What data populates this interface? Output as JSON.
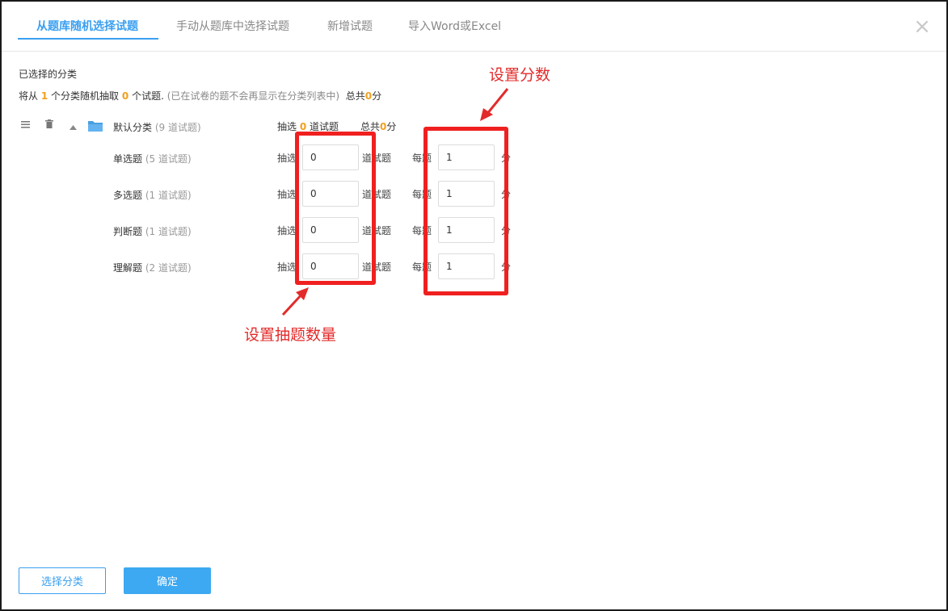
{
  "tabs": [
    {
      "label": "从题库随机选择试题"
    },
    {
      "label": "手动从题库中选择试题"
    },
    {
      "label": "新增试题"
    },
    {
      "label": "导入Word或Excel"
    }
  ],
  "close_symbol": "×",
  "selected_label": "已选择的分类",
  "summary": {
    "prefix": "将从",
    "category_count": "1",
    "middle": "个分类随机抽取",
    "question_count": "0",
    "suffix": "个试题.",
    "hint": "(已在试卷的题不会再显示在分类列表中)",
    "total_label": "总共",
    "total_value": "0",
    "total_unit": "分"
  },
  "category": {
    "name": "默认分类",
    "count": "(9 道试题)",
    "pick_label": "抽选",
    "pick_value": "0",
    "pick_unit": "道试题",
    "total_label": "总共",
    "total_value": "0",
    "total_unit": "分",
    "icons": {
      "menu": "menu-icon",
      "delete": "trash-icon",
      "collapse": "caret-up-icon",
      "folder": "folder-icon"
    }
  },
  "question_types": [
    {
      "name": "单选题",
      "count": "(5 道试题)",
      "pick_label": "抽选",
      "pick_value": "0",
      "unit_label": "道试题",
      "each_label": "每题",
      "score_value": "1",
      "score_unit": "分"
    },
    {
      "name": "多选题",
      "count": "(1 道试题)",
      "pick_label": "抽选",
      "pick_value": "0",
      "unit_label": "道试题",
      "each_label": "每题",
      "score_value": "1",
      "score_unit": "分"
    },
    {
      "name": "判断题",
      "count": "(1 道试题)",
      "pick_label": "抽选",
      "pick_value": "0",
      "unit_label": "道试题",
      "each_label": "每题",
      "score_value": "1",
      "score_unit": "分"
    },
    {
      "name": "理解题",
      "count": "(2 道试题)",
      "pick_label": "抽选",
      "pick_value": "0",
      "unit_label": "道试题",
      "each_label": "每题",
      "score_value": "1",
      "score_unit": "分"
    }
  ],
  "annotations": {
    "score": "设置分数",
    "quantity": "设置抽题数量"
  },
  "buttons": {
    "select_category": "选择分类",
    "confirm": "确定"
  },
  "colors": {
    "accent": "#3a9ff0",
    "highlight_number": "#f0a020",
    "annotation_red": "#f02020"
  }
}
